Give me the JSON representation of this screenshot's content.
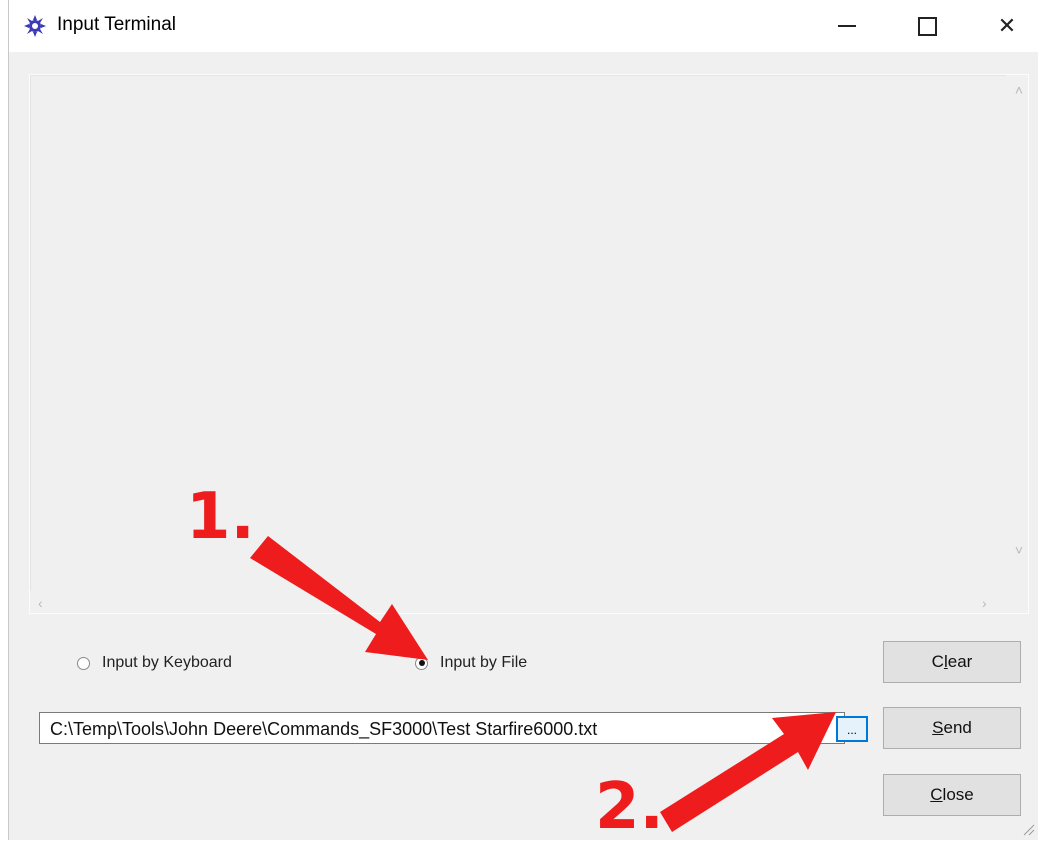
{
  "window": {
    "title": "Input Terminal",
    "icon": "gear-icon",
    "controls": {
      "minimize": "minimize-icon",
      "maximize": "maximize-icon",
      "close": "✕"
    }
  },
  "output_area": {
    "text": ""
  },
  "input_mode": {
    "options": [
      {
        "label": "Input by Keyboard",
        "selected": false
      },
      {
        "label": "Input by File",
        "selected": true
      }
    ]
  },
  "file": {
    "path": "C:\\Temp\\Tools\\John Deere\\Commands_SF3000\\Test Starfire6000.txt",
    "browse_label": "..."
  },
  "buttons": {
    "clear": {
      "pre": "C",
      "accel": "l",
      "post": "ear"
    },
    "send": {
      "pre": "",
      "accel": "S",
      "post": "end"
    },
    "close": {
      "pre": "",
      "accel": "C",
      "post": "lose"
    }
  },
  "annotations": {
    "step1": "1.",
    "step2": "2.",
    "color": "#ee1c1c"
  }
}
